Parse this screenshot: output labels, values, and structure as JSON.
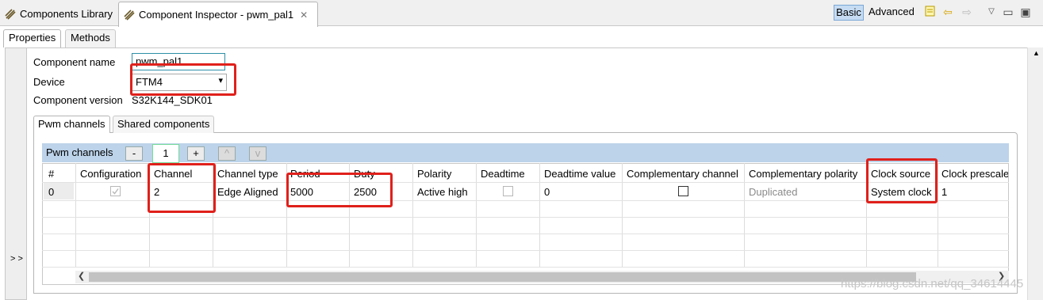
{
  "editor_tabs": [
    {
      "label": "Components Library"
    },
    {
      "label": "Component Inspector - pwm_pal1"
    }
  ],
  "toolbar": {
    "basic": "Basic",
    "advanced": "Advanced"
  },
  "view_tabs": {
    "properties": "Properties",
    "methods": "Methods"
  },
  "gutter": {
    "expand": "> >"
  },
  "fields": {
    "component_name_label": "Component name",
    "component_name_value": "pwm_pal1",
    "device_label": "Device",
    "device_value": "FTM4",
    "component_version_label": "Component version",
    "component_version_value": "S32K144_SDK01"
  },
  "inner_tabs": {
    "pwm_channels": "Pwm channels",
    "shared_components": "Shared components"
  },
  "channels": {
    "title": "Pwm channels",
    "count": "1",
    "buttons": {
      "minus": "-",
      "plus": "+",
      "up": "^",
      "down": "v"
    }
  },
  "table": {
    "headers": [
      "#",
      "Configuration",
      "Channel",
      "Channel type",
      "Period",
      "Duty",
      "Polarity",
      "Deadtime",
      "Deadtime value",
      "Complementary channel",
      "Complementary polarity",
      "Clock source",
      "Clock prescale"
    ],
    "row": {
      "index": "0",
      "channel": "2",
      "channel_type": "Edge Aligned",
      "period": "5000",
      "duty": "2500",
      "polarity": "Active high",
      "deadtime_value": "0",
      "complementary_polarity": "Duplicated",
      "clock_source": "System clock",
      "clock_prescale": "1"
    }
  },
  "watermark": "https://blog.csdn.net/qq_34614445",
  "highlight_color": "#e0201b"
}
